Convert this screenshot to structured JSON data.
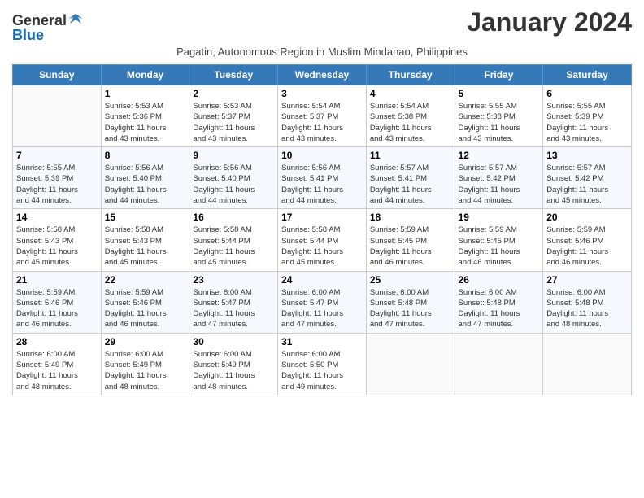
{
  "header": {
    "logo_general": "General",
    "logo_blue": "Blue",
    "month": "January 2024",
    "subtitle": "Pagatin, Autonomous Region in Muslim Mindanao, Philippines"
  },
  "weekdays": [
    "Sunday",
    "Monday",
    "Tuesday",
    "Wednesday",
    "Thursday",
    "Friday",
    "Saturday"
  ],
  "weeks": [
    [
      {
        "day": "",
        "info": ""
      },
      {
        "day": "1",
        "info": "Sunrise: 5:53 AM\nSunset: 5:36 PM\nDaylight: 11 hours\nand 43 minutes."
      },
      {
        "day": "2",
        "info": "Sunrise: 5:53 AM\nSunset: 5:37 PM\nDaylight: 11 hours\nand 43 minutes."
      },
      {
        "day": "3",
        "info": "Sunrise: 5:54 AM\nSunset: 5:37 PM\nDaylight: 11 hours\nand 43 minutes."
      },
      {
        "day": "4",
        "info": "Sunrise: 5:54 AM\nSunset: 5:38 PM\nDaylight: 11 hours\nand 43 minutes."
      },
      {
        "day": "5",
        "info": "Sunrise: 5:55 AM\nSunset: 5:38 PM\nDaylight: 11 hours\nand 43 minutes."
      },
      {
        "day": "6",
        "info": "Sunrise: 5:55 AM\nSunset: 5:39 PM\nDaylight: 11 hours\nand 43 minutes."
      }
    ],
    [
      {
        "day": "7",
        "info": ""
      },
      {
        "day": "8",
        "info": "Sunrise: 5:56 AM\nSunset: 5:40 PM\nDaylight: 11 hours\nand 44 minutes."
      },
      {
        "day": "9",
        "info": "Sunrise: 5:56 AM\nSunset: 5:40 PM\nDaylight: 11 hours\nand 44 minutes."
      },
      {
        "day": "10",
        "info": "Sunrise: 5:56 AM\nSunset: 5:41 PM\nDaylight: 11 hours\nand 44 minutes."
      },
      {
        "day": "11",
        "info": "Sunrise: 5:57 AM\nSunset: 5:41 PM\nDaylight: 11 hours\nand 44 minutes."
      },
      {
        "day": "12",
        "info": "Sunrise: 5:57 AM\nSunset: 5:42 PM\nDaylight: 11 hours\nand 44 minutes."
      },
      {
        "day": "13",
        "info": "Sunrise: 5:57 AM\nSunset: 5:42 PM\nDaylight: 11 hours\nand 45 minutes."
      }
    ],
    [
      {
        "day": "14",
        "info": ""
      },
      {
        "day": "15",
        "info": "Sunrise: 5:58 AM\nSunset: 5:43 PM\nDaylight: 11 hours\nand 45 minutes."
      },
      {
        "day": "16",
        "info": "Sunrise: 5:58 AM\nSunset: 5:44 PM\nDaylight: 11 hours\nand 45 minutes."
      },
      {
        "day": "17",
        "info": "Sunrise: 5:58 AM\nSunset: 5:44 PM\nDaylight: 11 hours\nand 45 minutes."
      },
      {
        "day": "18",
        "info": "Sunrise: 5:59 AM\nSunset: 5:45 PM\nDaylight: 11 hours\nand 46 minutes."
      },
      {
        "day": "19",
        "info": "Sunrise: 5:59 AM\nSunset: 5:45 PM\nDaylight: 11 hours\nand 46 minutes."
      },
      {
        "day": "20",
        "info": "Sunrise: 5:59 AM\nSunset: 5:46 PM\nDaylight: 11 hours\nand 46 minutes."
      }
    ],
    [
      {
        "day": "21",
        "info": ""
      },
      {
        "day": "22",
        "info": "Sunrise: 5:59 AM\nSunset: 5:46 PM\nDaylight: 11 hours\nand 46 minutes."
      },
      {
        "day": "23",
        "info": "Sunrise: 6:00 AM\nSunset: 5:47 PM\nDaylight: 11 hours\nand 47 minutes."
      },
      {
        "day": "24",
        "info": "Sunrise: 6:00 AM\nSunset: 5:47 PM\nDaylight: 11 hours\nand 47 minutes."
      },
      {
        "day": "25",
        "info": "Sunrise: 6:00 AM\nSunset: 5:48 PM\nDaylight: 11 hours\nand 47 minutes."
      },
      {
        "day": "26",
        "info": "Sunrise: 6:00 AM\nSunset: 5:48 PM\nDaylight: 11 hours\nand 47 minutes."
      },
      {
        "day": "27",
        "info": "Sunrise: 6:00 AM\nSunset: 5:48 PM\nDaylight: 11 hours\nand 48 minutes."
      }
    ],
    [
      {
        "day": "28",
        "info": ""
      },
      {
        "day": "29",
        "info": "Sunrise: 6:00 AM\nSunset: 5:49 PM\nDaylight: 11 hours\nand 48 minutes."
      },
      {
        "day": "30",
        "info": "Sunrise: 6:00 AM\nSunset: 5:49 PM\nDaylight: 11 hours\nand 48 minutes."
      },
      {
        "day": "31",
        "info": "Sunrise: 6:00 AM\nSunset: 5:50 PM\nDaylight: 11 hours\nand 49 minutes."
      },
      {
        "day": "",
        "info": ""
      },
      {
        "day": "",
        "info": ""
      },
      {
        "day": "",
        "info": ""
      }
    ]
  ],
  "week1_day7_info": "Sunrise: 5:55 AM\nSunset: 5:39 PM\nDaylight: 11 hours\nand 44 minutes.",
  "week2_day14_info": "Sunrise: 5:58 AM\nSunset: 5:43 PM\nDaylight: 11 hours\nand 45 minutes.",
  "week3_day21_info": "Sunrise: 5:59 AM\nSunset: 5:46 PM\nDaylight: 11 hours\nand 46 minutes.",
  "week4_day28_info": "Sunrise: 6:00 AM\nSunset: 5:49 PM\nDaylight: 11 hours\nand 48 minutes."
}
